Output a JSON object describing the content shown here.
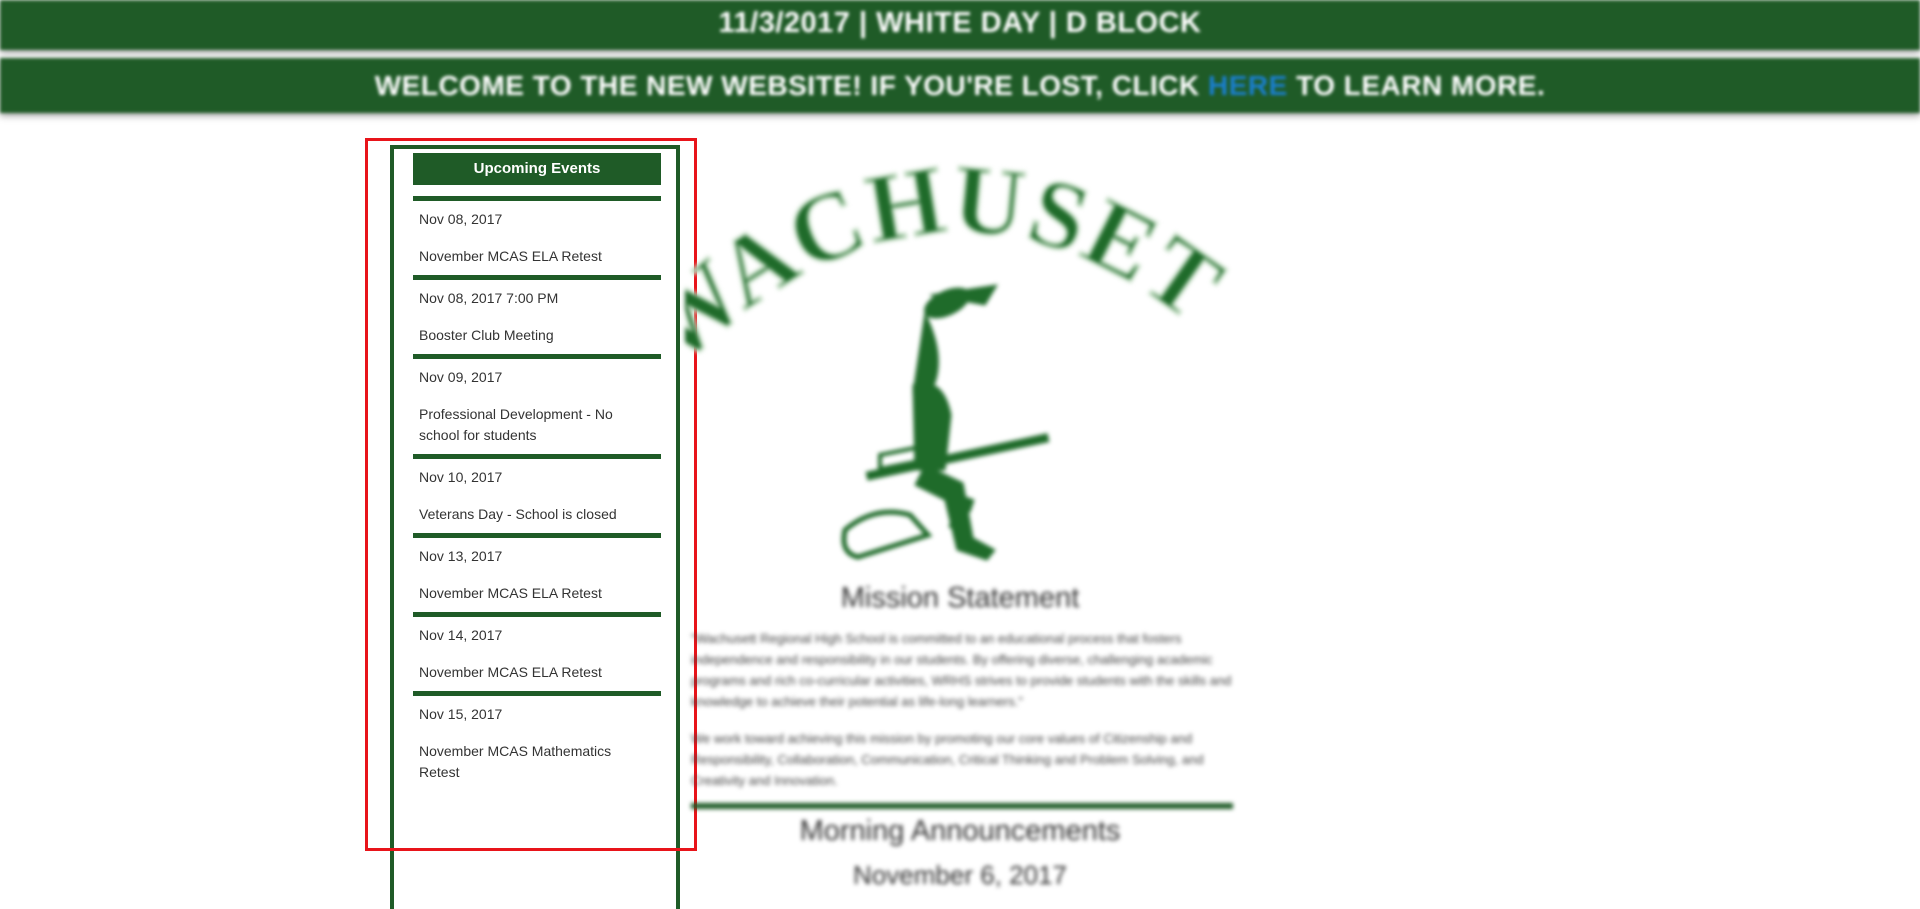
{
  "banners": {
    "day_info": "11/3/2017 | WHITE DAY | D BLOCK",
    "welcome_prefix": "WELCOME TO THE NEW WEBSITE! IF YOU'RE LOST, CLICK",
    "welcome_link": "HERE",
    "welcome_suffix": "TO LEARN MORE."
  },
  "sidebar": {
    "title": "Upcoming Events",
    "events": [
      {
        "date": "Nov 08, 2017",
        "title": "November MCAS ELA Retest"
      },
      {
        "date": "Nov 08, 2017 7:00 PM",
        "title": "Booster Club Meeting"
      },
      {
        "date": "Nov 09, 2017",
        "title": "Professional Development - No school for students"
      },
      {
        "date": "Nov 10, 2017",
        "title": "Veterans Day - School is closed"
      },
      {
        "date": "Nov 13, 2017",
        "title": "November MCAS ELA Retest"
      },
      {
        "date": "Nov 14, 2017",
        "title": "November MCAS ELA Retest"
      },
      {
        "date": "Nov 15, 2017",
        "title": "November MCAS Mathematics Retest"
      }
    ]
  },
  "main": {
    "logo_text": "WACHUSETT",
    "mission_title": "Mission Statement",
    "mission_paragraph_1": "\"Wachusett Regional High School is committed to an educational process that fosters independence and responsibility in our students. By offering diverse, challenging academic programs and rich co-curricular activities, WRHS strives to provide students with the skills and knowledge to achieve their potential as life-long learners.\"",
    "mission_paragraph_2": "We work toward achieving this mission by promoting our core values of Citizenship and Responsibility, Collaboration, Communication, Critical Thinking and Problem Solving, and Creativity and Innovation.",
    "announcements_title": "Morning Announcements",
    "announcements_date": "November 6, 2017"
  },
  "colors": {
    "brand_green": "#1f5b27",
    "link_blue": "#1a7fcf",
    "highlight_red": "#e8141a"
  }
}
